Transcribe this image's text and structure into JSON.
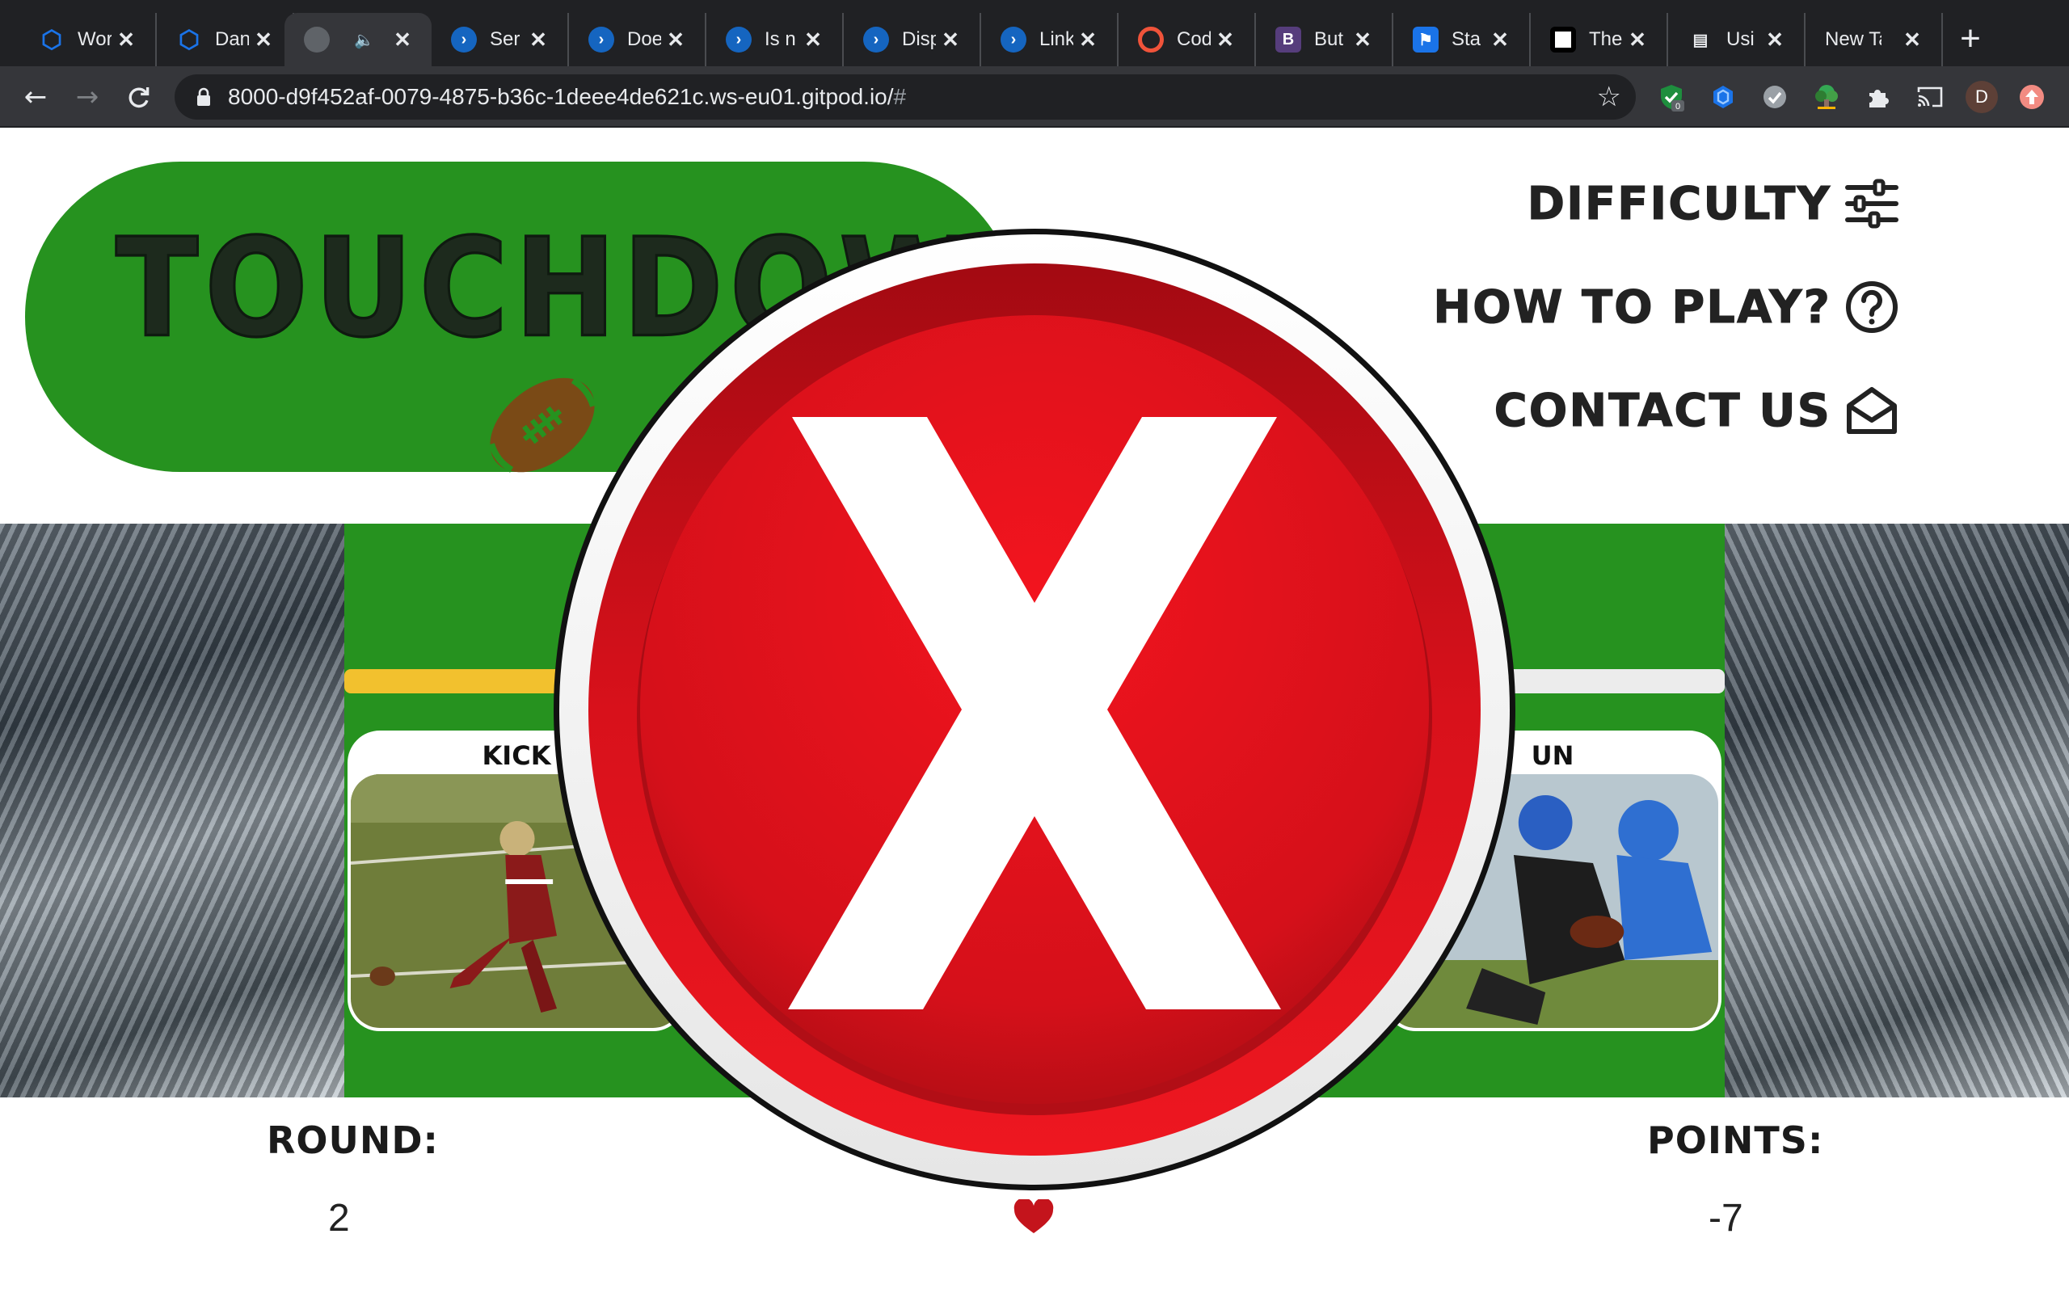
{
  "browser": {
    "tabs": [
      {
        "title": "Wor",
        "favicon": "gitpod-hexagon-icon",
        "color": "#1a73e8"
      },
      {
        "title": "Dan",
        "favicon": "gitpod-hexagon-icon",
        "color": "#1a73e8"
      },
      {
        "title": "",
        "favicon": "globe-icon",
        "color": "#5f6368",
        "audio": true,
        "active": true
      },
      {
        "title": "Ser",
        "favicon": "powershell-icon",
        "color": "#fff"
      },
      {
        "title": "Doe",
        "favicon": "powershell-icon",
        "color": "#fff"
      },
      {
        "title": "Is n",
        "favicon": "powershell-icon",
        "color": "#fff"
      },
      {
        "title": "Disp",
        "favicon": "powershell-icon",
        "color": "#fff"
      },
      {
        "title": "Link",
        "favicon": "powershell-icon",
        "color": "#fff"
      },
      {
        "title": "Cod",
        "favicon": "codepen-icon",
        "color": "#f0533a"
      },
      {
        "title": "But",
        "favicon": "bootstrap-icon",
        "color": "#563d7c",
        "glyph": "B"
      },
      {
        "title": "Sta",
        "favicon": "flag-icon",
        "color": "#1a73e8"
      },
      {
        "title": "The",
        "favicon": "qr-icon",
        "color": "#000"
      },
      {
        "title": "Usi",
        "favicon": "card-icon",
        "color": "#3c4043"
      },
      {
        "title": "New Ta",
        "favicon": "",
        "color": ""
      }
    ],
    "url": "8000-d9f452af-0079-4875-b36c-1deee4de621c.ws-eu01.gitpod.io/",
    "url_hash": "#",
    "extension_badge": "0",
    "profile_initial": "D"
  },
  "game": {
    "title": "TOUCHDOWN",
    "menu": {
      "difficulty": "DIFFICULTY",
      "how_to_play": "HOW TO PLAY?",
      "contact": "CONTACT US"
    },
    "cards": {
      "left_label": "KICK",
      "right_label": "UN"
    },
    "stats": {
      "round_label": "ROUND:",
      "round_value": "2",
      "points_label": "POINTS:",
      "points_value": "-7",
      "lives": 1
    },
    "result": "wrong-answer-x-icon"
  },
  "colors": {
    "field_green": "#26921f",
    "progress_yellow": "#f2c12e",
    "badge_red": "#e0141c",
    "heart_red": "#c4141c"
  }
}
